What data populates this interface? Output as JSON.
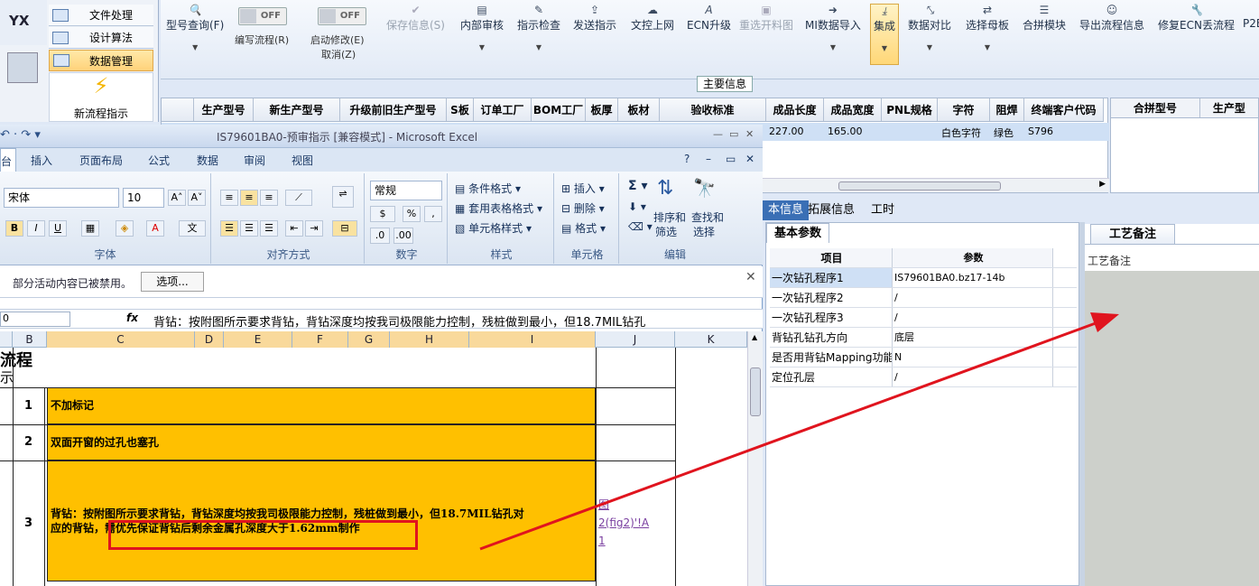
{
  "leftnav": {
    "logo": "YX",
    "items": [
      {
        "label": "文件处理"
      },
      {
        "label": "设计算法"
      },
      {
        "label": "数据管理"
      }
    ],
    "new_flow": "新流程指示"
  },
  "toolbar": {
    "buttons": [
      {
        "label": "型号查询(F)",
        "icon": "search-icon"
      },
      {
        "label": "保存信息(S)",
        "icon": "check-icon"
      },
      {
        "label": "内部审核",
        "icon": "print-icon"
      },
      {
        "label": "指示检查",
        "icon": "edit-icon"
      },
      {
        "label": "发送指示",
        "icon": "upload-icon"
      },
      {
        "label": "文控上网",
        "icon": "cloud-upload-icon"
      },
      {
        "label": "ECN升级",
        "icon": "text-a-icon"
      },
      {
        "label": "重选开料图",
        "icon": "image-icon"
      },
      {
        "label": "MI数据导入",
        "icon": "import-icon"
      },
      {
        "label": "集成",
        "icon": "download-icon"
      },
      {
        "label": "数据对比",
        "icon": "compress-icon"
      },
      {
        "label": "选择母板",
        "icon": "shuffle-icon"
      },
      {
        "label": "合拼模块",
        "icon": "list-icon"
      },
      {
        "label": "导出流程信息",
        "icon": "smile-icon"
      },
      {
        "label": "修复ECN丢流程",
        "icon": "wrench-icon"
      },
      {
        "label": "P2E",
        "icon": ""
      }
    ],
    "toggles": [
      {
        "state": "OFF",
        "label": "编写流程(R)"
      },
      {
        "state": "OFF",
        "label": "启动修改(E)",
        "label2": "取消(Z)"
      }
    ],
    "main_info": "主要信息"
  },
  "grid": {
    "headers": [
      "生产型号",
      "新生产型号",
      "升级前旧生产型号",
      "S板",
      "订单工厂",
      "BOM工厂",
      "板厚",
      "板材",
      "验收标准",
      "成品长度",
      "成品宽度",
      "PNL规格",
      "字符",
      "阻焊",
      "终端客户代码"
    ],
    "row": {
      "len": "227.00",
      "wid": "165.00",
      "char": "白色字符",
      "mask": "绿色",
      "cust": "S796"
    },
    "right_headers": [
      "合拼型号",
      "生产型"
    ]
  },
  "info_tabs": [
    "本信息",
    "拓展信息",
    "工时"
  ],
  "params": {
    "title": "基本参数",
    "headers": [
      "项目",
      "参数"
    ],
    "rows": [
      {
        "k": "一次钻孔程序1",
        "v": "IS79601BA0.bz17-14b"
      },
      {
        "k": "一次钻孔程序2",
        "v": "/"
      },
      {
        "k": "一次钻孔程序3",
        "v": "/"
      },
      {
        "k": "背钻孔钻孔方向",
        "v": "底层"
      },
      {
        "k": "是否用背钻Mapping功能",
        "v": "N"
      },
      {
        "k": "定位孔层",
        "v": "/"
      }
    ]
  },
  "notes": {
    "tab": "工艺备注",
    "label": "工艺备注"
  },
  "excel": {
    "title": "IS79601BA0-预审指示  [兼容模式] - Microsoft Excel",
    "tabs": [
      "台",
      "插入",
      "页面布局",
      "公式",
      "数据",
      "审阅",
      "视图"
    ],
    "font_name": "宋体",
    "font_size": "10",
    "number_format": "常规",
    "groups": [
      "字体",
      "对齐方式",
      "数字",
      "样式",
      "单元格",
      "编辑"
    ],
    "style_items": [
      "条件格式",
      "套用表格格式",
      "单元格样式"
    ],
    "cell_items": [
      "插入",
      "删除",
      "格式"
    ],
    "edit_items": [
      "排序和",
      "筛选",
      "查找和",
      "选择"
    ],
    "security": "部分活动内容已被禁用。",
    "options": "选项...",
    "namebox": "0",
    "formula": "背钻：按附图所示要求背钻，背钻深度均按我司极限能力控制，残桩做到最小，但18.7MIL钻孔",
    "columns": [
      "B",
      "C",
      "D",
      "E",
      "F",
      "G",
      "H",
      "I",
      "J",
      "K"
    ],
    "header_cell": "流程",
    "header_cell2": "示",
    "rows": [
      {
        "n": "1",
        "text": "不加标记"
      },
      {
        "n": "2",
        "text": "双面开窗的过孔也塞孔"
      },
      {
        "n": "3",
        "text": "背钻：按附图所示要求背钻，背钻深度均按我司极限能力控制，残桩做到最小，但18.7MIL钻孔对",
        "text2": "应的背钻，需优先保证背钻后剩余金属孔深度大于1.62mm制作",
        "link1": "图",
        "link2": "2(fig2)'!A",
        "link3": "1"
      }
    ]
  }
}
